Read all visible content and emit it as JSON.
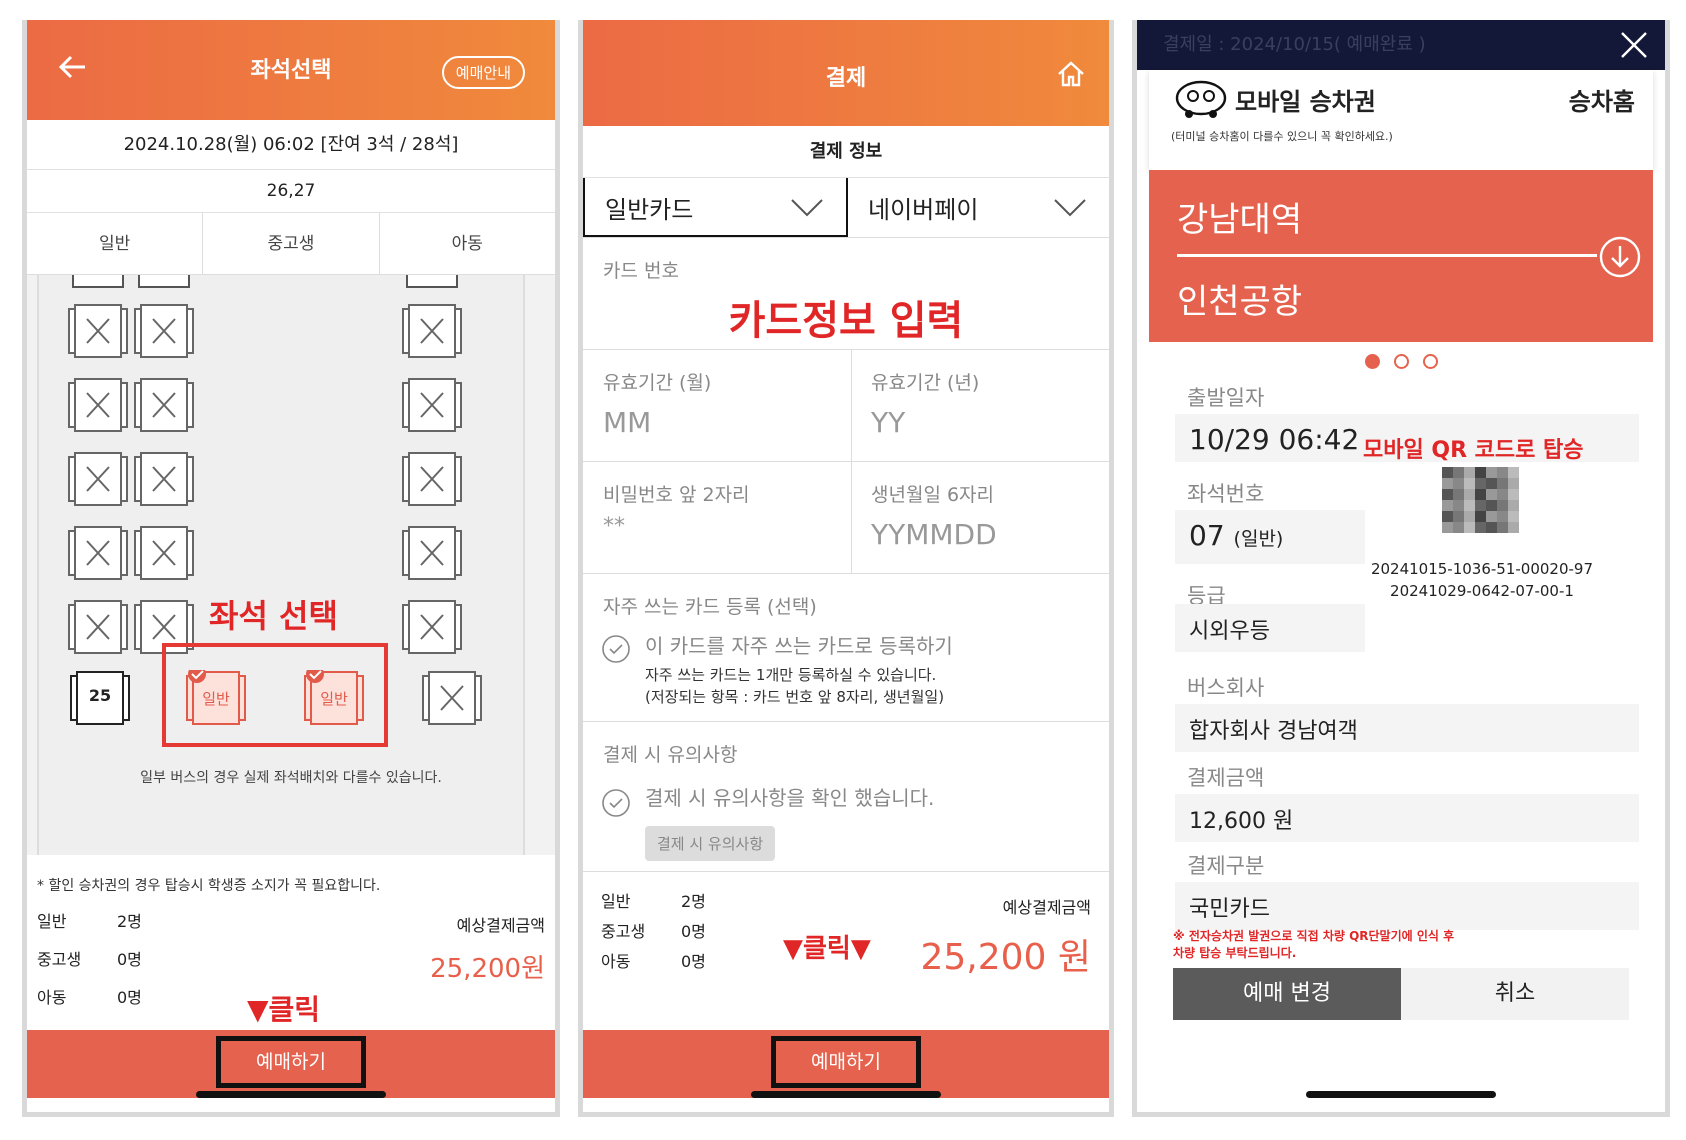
{
  "screen1": {
    "header_title": "좌석선택",
    "header_pill": "예매안내",
    "date_bar": "2024.10.28(월) 06:02 [잔여 3석 / 28석]",
    "selected_seats": "26,27",
    "tabs": [
      "일반",
      "중고생",
      "아동"
    ],
    "seat_number": "25",
    "selected_seat_labels": [
      "일반",
      "일반"
    ],
    "annotation_select": "좌석 선택",
    "layout_notice": "일부 버스의 경우 실제 좌석배치와 다를수 있습니다.",
    "discount_note": "* 할인 승차권의 경우 탑승시 학생증 소지가 꼭 필요합니다.",
    "counts": [
      {
        "label": "일반",
        "value": "2명"
      },
      {
        "label": "중고생",
        "value": "0명"
      },
      {
        "label": "아동",
        "value": "0명"
      }
    ],
    "price_label": "예상결제금액",
    "price": "25,200원",
    "annotation_click": "▼클릭",
    "cta": "예매하기"
  },
  "screen2": {
    "header_title": "결제",
    "section_title": "결제 정보",
    "card_type": "일반카드",
    "pay_type": "네이버페이",
    "card_number_label": "카드 번호",
    "annotation_card": "카드정보 입력",
    "exp_month_label": "유효기간 (월)",
    "exp_month_ph": "MM",
    "exp_year_label": "유효기간 (년)",
    "exp_year_ph": "YY",
    "pw_label": "비밀번호 앞 2자리",
    "pw_ph": "**",
    "birth_label": "생년월일 6자리",
    "birth_ph": "YYMMDD",
    "frequent_title": "자주 쓰는 카드 등록 (선택)",
    "frequent_check": "이 카드를 자주 쓰는 카드로 등록하기",
    "frequent_note1": "자주 쓰는 카드는 1개만 등록하실 수 있습니다.",
    "frequent_note2": "(저장되는 항목 : 카드 번호 앞 8자리, 생년월일)",
    "caution_title": "결제 시 유의사항",
    "caution_check": "결제 시 유의사항을 확인 했습니다.",
    "caution_btn": "결제 시 유의사항",
    "counts": [
      {
        "label": "일반",
        "value": "2명"
      },
      {
        "label": "중고생",
        "value": "0명"
      },
      {
        "label": "아동",
        "value": "0명"
      }
    ],
    "price_label": "예상결제금액",
    "price": "25,200 원",
    "annotation_click": "▼클릭▼",
    "cta": "예매하기"
  },
  "screen3": {
    "top_text": "결제일 : 2024/10/15( 예매완료 )",
    "title": "모바일 승차권",
    "platform": "승차홈",
    "subnote": "(터미널 승차홈이 다를수 있으니 꼭 확인하세요.)",
    "origin": "강남대역",
    "destination": "인천공항",
    "depart_label": "출발일자",
    "depart_value": "10/29 06:42",
    "annotation_qr": "모바일 QR 코드로 탑승",
    "seat_label": "좌석번호",
    "seat_value": "07",
    "seat_type": "(일반)",
    "grade_label": "등급",
    "grade_value": "시외우등",
    "code1": "20241015-1036-51-00020-97",
    "code2": "20241029-0642-07-00-1",
    "company_label": "버스회사",
    "company_value": "합자회사 경남여객",
    "amount_label": "결제금액",
    "amount_value": "12,600 원",
    "pay_label": "결제구분",
    "pay_value": "국민카드",
    "warning1": "※ 전자승차권 발권으로 직접 차량 QR단말기에 인식 후",
    "warning2": "차량 탑승 부탁드립니다.",
    "btn_change": "예매 변경",
    "btn_cancel": "취소"
  },
  "colors": {
    "brand": "#e4624e",
    "header_from": "#ec6a44",
    "header_to": "#f08a3c",
    "annotation": "#e02626"
  }
}
